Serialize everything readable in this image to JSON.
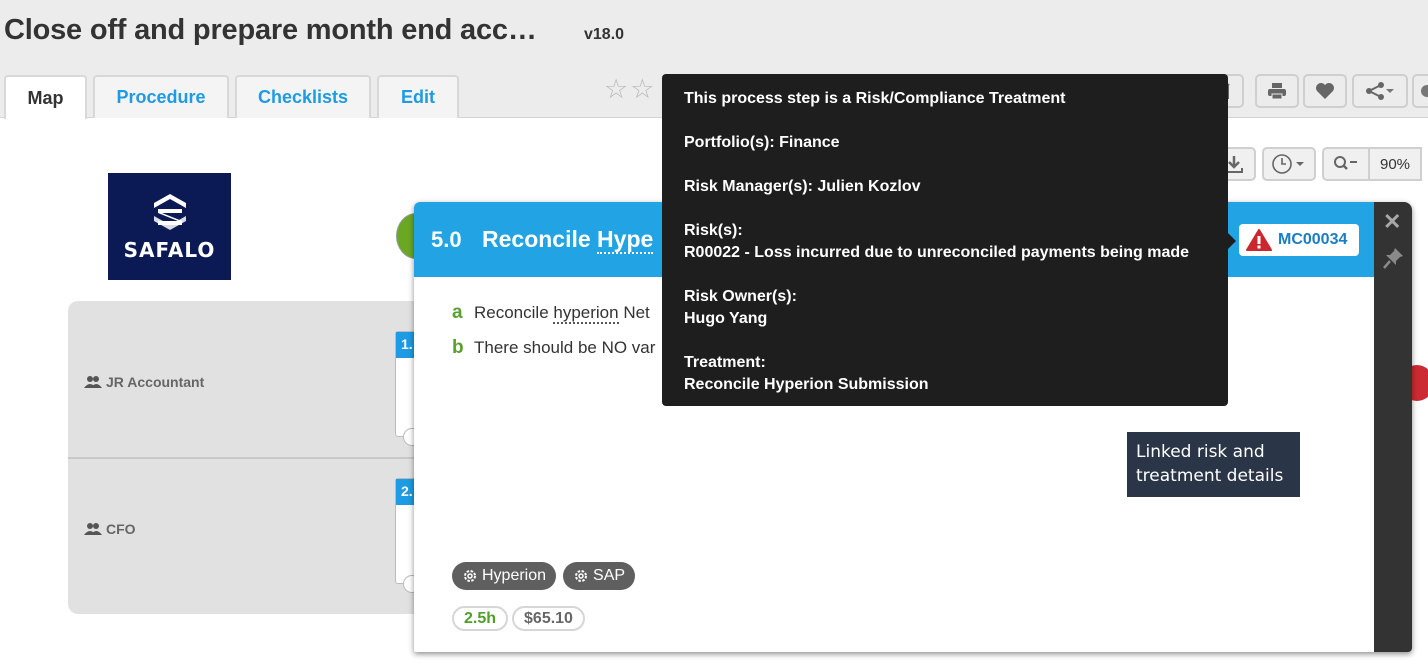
{
  "header": {
    "title": "Close off and prepare month end acc…",
    "version": "v18.0"
  },
  "tabs": [
    {
      "label": "Map",
      "active": true
    },
    {
      "label": "Procedure",
      "active": false
    },
    {
      "label": "Checklists",
      "active": false
    },
    {
      "label": "Edit",
      "active": false
    }
  ],
  "rating": {
    "stars_shown": 2,
    "filled": 0
  },
  "toolbar": {
    "icons": [
      "edit-icon",
      "print-icon",
      "favorite-heart-icon",
      "share-icon",
      "settings-icon"
    ],
    "view_icons": [
      "download-icon",
      "history-icon",
      "zoom-out-icon"
    ],
    "zoom_level": "90%"
  },
  "logo": {
    "text": "SAFALO"
  },
  "lanes": [
    {
      "label": "JR Accountant",
      "card_num": "1."
    },
    {
      "label": "CFO",
      "card_num": "2."
    }
  ],
  "step": {
    "number": "5.0",
    "title": "Reconcile Hype",
    "badge": "MC00034",
    "substeps": [
      {
        "letter": "a",
        "text_before": "Reconcile ",
        "link": "hyperion",
        "text_after": " Net"
      },
      {
        "letter": "b",
        "text": "There should be NO var"
      }
    ],
    "systems": [
      "Hyperion",
      "SAP"
    ],
    "duration": "2.5h",
    "cost": "$65.10"
  },
  "tooltip": {
    "heading": "This process step is a Risk/Compliance Treatment",
    "portfolio": "Portfolio(s): Finance",
    "risk_manager": "Risk Manager(s): Julien Kozlov",
    "risks_label": "Risk(s):",
    "risk": "R00022 - Loss incurred due to unreconciled payments being made",
    "owner_label": "Risk Owner(s):",
    "owner": "Hugo Yang",
    "treatment_label": "Treatment:",
    "treatment": "Reconcile Hyperion Submission"
  },
  "callout": {
    "text": "Linked risk and treatment details"
  },
  "colors": {
    "accent": "#22a3e3",
    "tab_link": "#1e9be2",
    "substep_letter": "#5aa02c",
    "alert_red": "#cc2b33",
    "tooltip_bg": "#1e1e1e",
    "callout_bg": "#2b3548"
  }
}
